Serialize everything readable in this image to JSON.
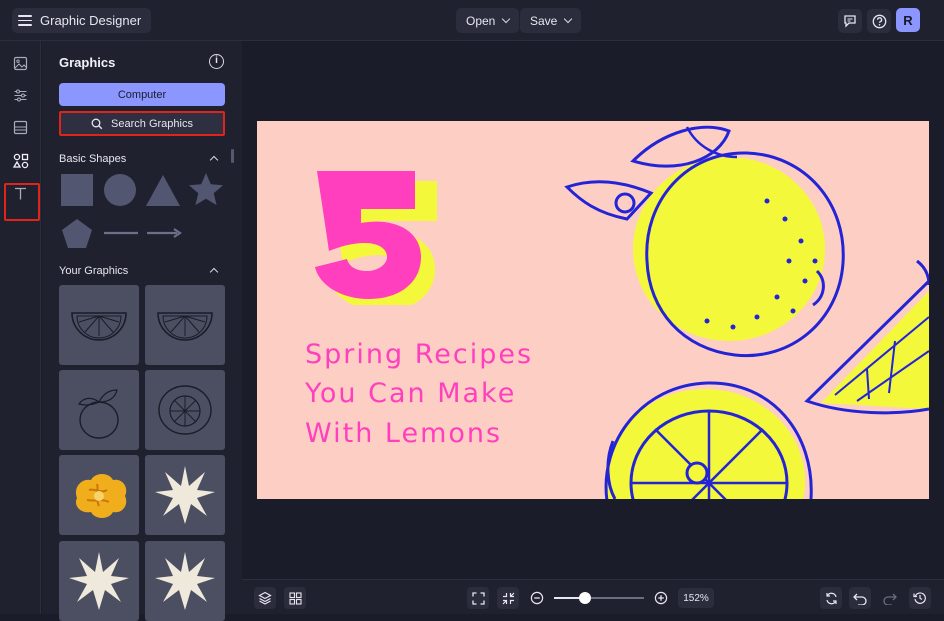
{
  "header": {
    "app_title": "Graphic Designer",
    "open_label": "Open",
    "save_label": "Save",
    "avatar_initial": "R"
  },
  "rail": {
    "items": [
      {
        "name": "photos",
        "icon": "image-icon"
      },
      {
        "name": "adjustments",
        "icon": "sliders-icon"
      },
      {
        "name": "layout",
        "icon": "layout-icon"
      },
      {
        "name": "graphics",
        "icon": "shapes-icon",
        "active": true
      },
      {
        "name": "text",
        "icon": "text-icon"
      }
    ]
  },
  "panel": {
    "title": "Graphics",
    "computer_label": "Computer",
    "search_label": "Search Graphics",
    "basic_shapes_label": "Basic Shapes",
    "your_graphics_label": "Your Graphics",
    "shapes": [
      "square",
      "circle",
      "triangle",
      "star",
      "pentagon",
      "line",
      "arrow"
    ],
    "graphics": [
      "lemon-slice-outline",
      "lemon-slice-outline",
      "lemon-leaf-outline",
      "lemon-half-outline",
      "yellow-flower",
      "cream-starburst",
      "cream-starburst",
      "cream-starburst"
    ]
  },
  "design": {
    "number": "5",
    "lines": [
      "Spring Recipes",
      "You Can Make",
      "With Lemons"
    ],
    "colors": {
      "background": "#fdcfc4",
      "accent": "#ff3fbe",
      "lemon": "#f3f83a",
      "ink": "#2424d6"
    }
  },
  "footer": {
    "zoom": "152%",
    "zoom_level": 0.34
  }
}
